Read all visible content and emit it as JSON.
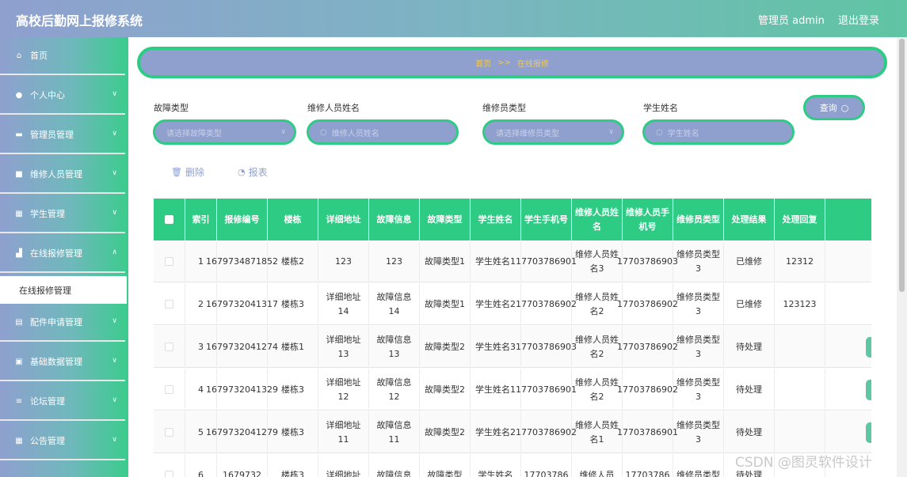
{
  "header": {
    "title": "高校后勤网上报修系统",
    "admin": "管理员 admin",
    "logout": "退出登录"
  },
  "sidebar": {
    "items": [
      {
        "label": "首页"
      },
      {
        "label": "个人中心"
      },
      {
        "label": "管理员管理"
      },
      {
        "label": "维修人员管理"
      },
      {
        "label": "学生管理"
      },
      {
        "label": "在线报修管理"
      },
      {
        "label": "配件申请管理"
      },
      {
        "label": "基础数据管理"
      },
      {
        "label": "论坛管理"
      },
      {
        "label": "公告管理"
      }
    ],
    "active_sub": "在线报修管理"
  },
  "breadcrumb": {
    "home": "首页",
    "sep": ">>",
    "current": "在线报修"
  },
  "filters": {
    "fault_type": {
      "label": "故障类型",
      "placeholder": "请选择故障类型"
    },
    "repairer_name": {
      "label": "维修人员姓名",
      "placeholder": "维修人员姓名"
    },
    "repairer_type": {
      "label": "维修员类型",
      "placeholder": "请选择维修员类型"
    },
    "student_name": {
      "label": "学生姓名",
      "placeholder": "学生姓名"
    },
    "query": "查询"
  },
  "actions": {
    "delete": "删除",
    "report": "报表"
  },
  "table": {
    "headers": [
      "索引",
      "报修编号",
      "楼栋",
      "详细地址",
      "故障信息",
      "故障类型",
      "学生姓名",
      "学生手机号",
      "维修人员姓名",
      "维修人员手机号",
      "维修员类型",
      "处理结果",
      "处理回复"
    ],
    "rows": [
      [
        "1",
        "1679734871852",
        "楼栋2",
        "123",
        "123",
        "故障类型1",
        "学生姓名1",
        "17703786901",
        "维修人员姓名3",
        "17703786903",
        "维修员类型3",
        "已维修",
        "12312"
      ],
      [
        "2",
        "1679732041317",
        "楼栋3",
        "详细地址14",
        "故障信息14",
        "故障类型1",
        "学生姓名2",
        "17703786902",
        "维修人员姓名2",
        "17703786902",
        "维修员类型3",
        "已维修",
        "123123"
      ],
      [
        "3",
        "1679732041274",
        "楼栋1",
        "详细地址13",
        "故障信息13",
        "故障类型2",
        "学生姓名3",
        "17703786903",
        "维修人员姓名2",
        "17703786902",
        "维修员类型3",
        "待处理",
        ""
      ],
      [
        "4",
        "1679732041329",
        "楼栋3",
        "详细地址12",
        "故障信息12",
        "故障类型2",
        "学生姓名1",
        "17703786901",
        "维修人员姓名2",
        "17703786902",
        "维修员类型3",
        "待处理",
        ""
      ],
      [
        "5",
        "1679732041279",
        "楼栋3",
        "详细地址11",
        "故障信息11",
        "故障类型2",
        "学生姓名2",
        "17703786902",
        "维修人员姓名1",
        "17703786901",
        "维修员类型3",
        "待处理",
        ""
      ],
      [
        "6",
        "1679732",
        "楼栋3",
        "详细地址",
        "故障信息",
        "故障类型",
        "学生姓名",
        "17703786",
        "维修人员",
        "17703786",
        "维修员类型",
        "待处理",
        ""
      ]
    ]
  },
  "watermark": "CSDN @图灵软件设计"
}
